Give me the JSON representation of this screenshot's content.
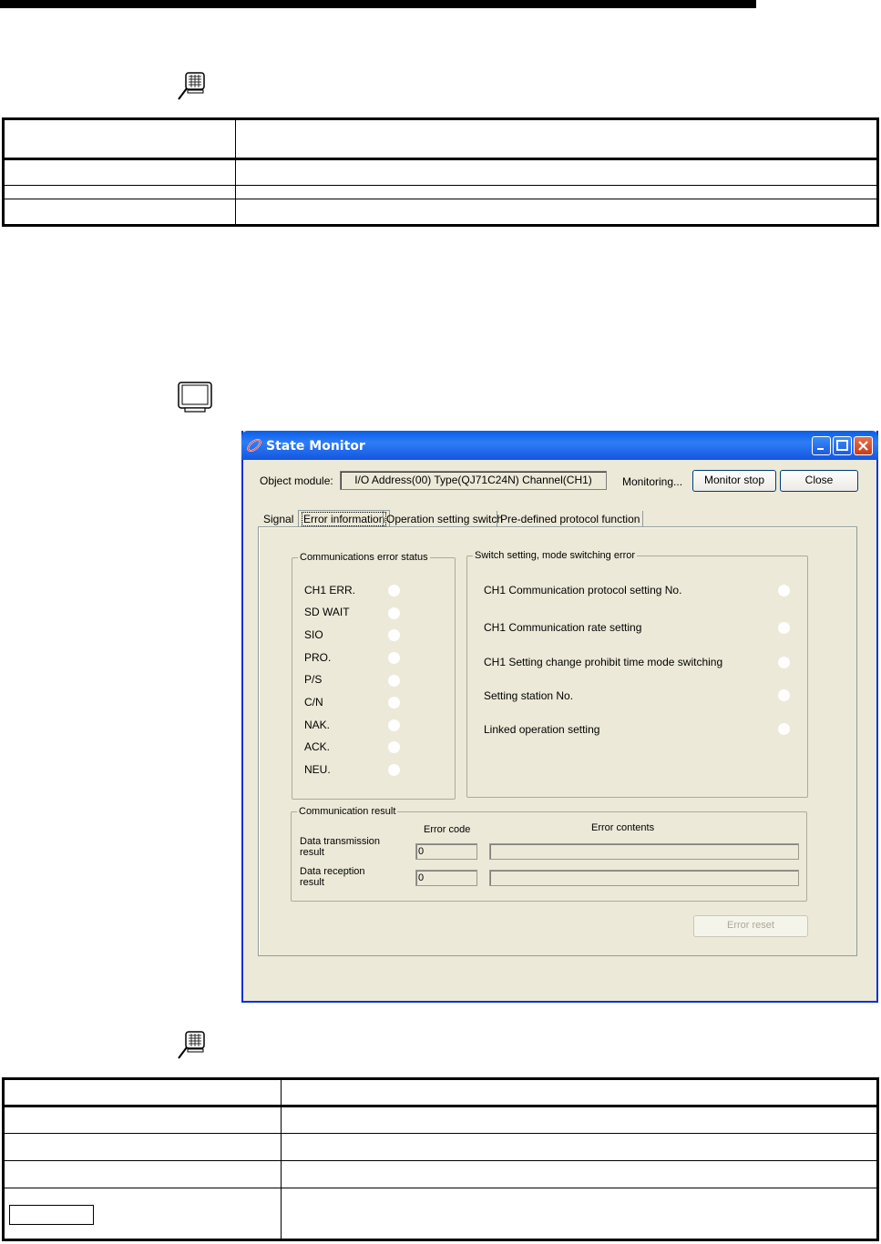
{
  "window": {
    "title": "State Monitor",
    "object_module_label": "Object module:",
    "object_module_value": "I/O Address(00) Type(QJ71C24N) Channel(CH1)",
    "status": "Monitoring...",
    "monitor_stop_label": "Monitor stop",
    "close_label": "Close"
  },
  "tabs": [
    {
      "label": "Signal"
    },
    {
      "label": "Error information"
    },
    {
      "label": "Operation setting switch"
    },
    {
      "label": "Pre-defined protocol function"
    }
  ],
  "comm_error": {
    "title": "Communications error status",
    "items": [
      "CH1 ERR.",
      "SD WAIT",
      "SIO",
      "PRO.",
      "P/S",
      "C/N",
      "NAK.",
      "ACK.",
      "NEU."
    ]
  },
  "switch_error": {
    "title": "Switch setting, mode switching error",
    "items": [
      "CH1 Communication protocol setting No.",
      "CH1 Communication rate setting",
      "CH1 Setting change prohibit time mode switching",
      "Setting station No.",
      "Linked operation setting"
    ]
  },
  "comm_result": {
    "title": "Communication result",
    "error_code_header": "Error code",
    "error_contents_header": "Error contents",
    "rows": [
      {
        "label_line1": "Data transmission",
        "label_line2": "result",
        "code": "0"
      },
      {
        "label_line1": "Data reception",
        "label_line2": "result",
        "code": "0"
      }
    ]
  },
  "error_reset_label": "Error reset",
  "icons": {
    "magnifier": "magnifier-monitor-icon",
    "monitor": "monitor-icon",
    "app": "state-monitor-app-icon"
  }
}
